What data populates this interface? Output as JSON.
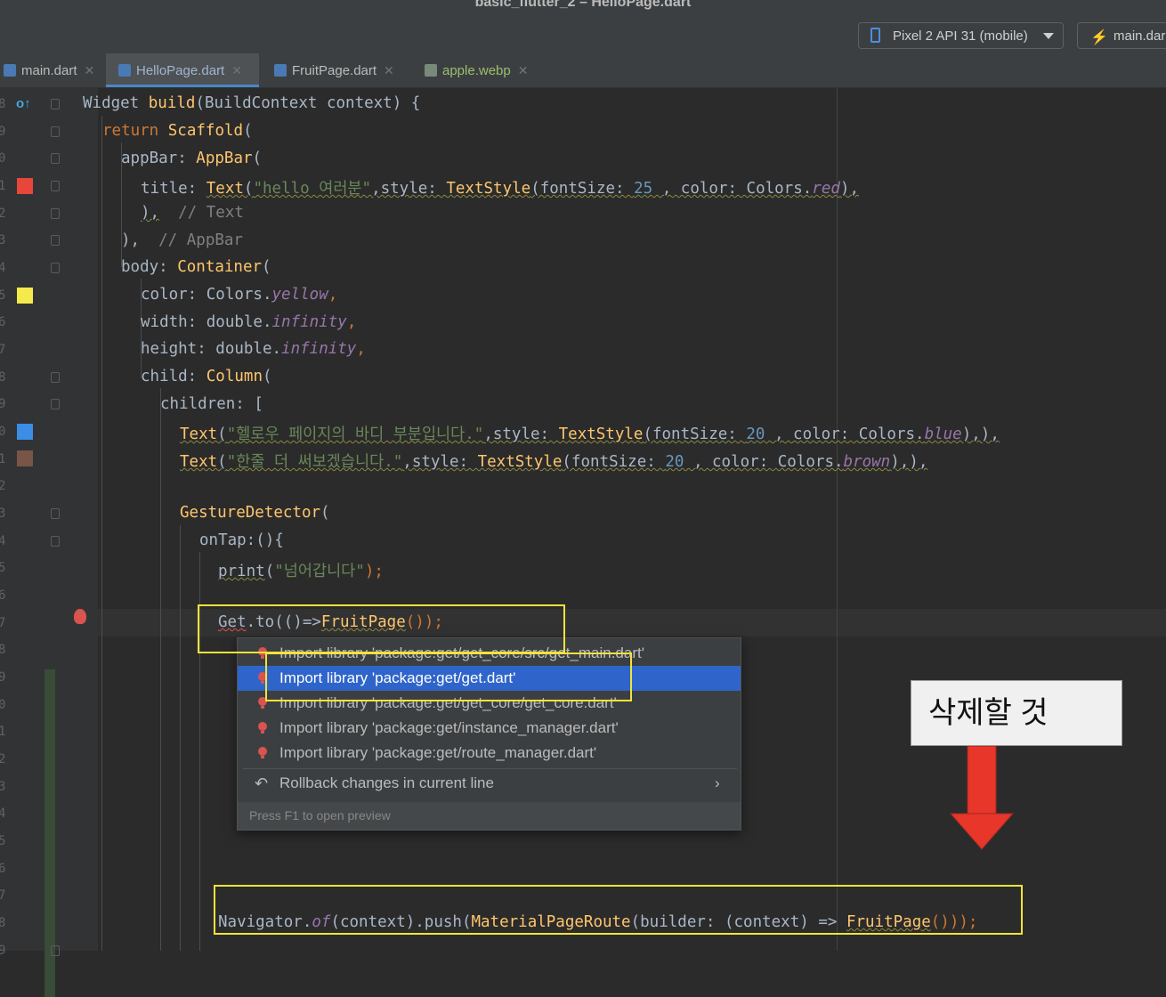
{
  "window": {
    "title": "basic_flutter_2 – HelloPage.dart"
  },
  "toolbar": {
    "device": "Pixel 2 API 31 (mobile)",
    "run_config": "main.dar"
  },
  "tabs": [
    {
      "label": "main.dart",
      "active": false
    },
    {
      "label": "HelloPage.dart",
      "active": true
    },
    {
      "label": "FruitPage.dart",
      "active": false
    },
    {
      "label": "apple.webp",
      "active": false
    }
  ],
  "gutter": {
    "line_numbers": [
      "8",
      "9",
      "0",
      "1",
      "2",
      "3",
      "4",
      "5",
      "6",
      "7",
      "8",
      "9",
      "0",
      "1",
      "2",
      "3",
      "4",
      "5",
      "6",
      "7",
      "8",
      "9",
      "0",
      "1",
      "2",
      "3",
      "4",
      "5",
      "6",
      "7",
      "8",
      "9"
    ],
    "color_swatches": {
      "red": "#e8463a",
      "yellow": "#f6e94c",
      "blue": "#3a8ee6",
      "brown": "#795548"
    }
  },
  "code": {
    "l1": {
      "a": "Widget ",
      "b": "build",
      "c": "(BuildContext context) {"
    },
    "l2": {
      "a": "return ",
      "b": "Scaffold",
      "c": "("
    },
    "l3": {
      "a": "appBar: ",
      "b": "AppBar",
      "c": "("
    },
    "l4": {
      "a": "title: ",
      "b": "Text",
      "c": "(",
      "d": "\"hello 여러분\"",
      "e": ",style: ",
      "f": "TextStyle",
      "g": "(fontSize: ",
      "h": "25",
      "i": " , color: Colors.",
      "j": "red",
      "k": "),",
      "l": ""
    },
    "l5": {
      "a": "),",
      "b": "  // Text"
    },
    "l6": {
      "a": "),",
      "b": "  // AppBar"
    },
    "l7": {
      "a": "body: ",
      "b": "Container",
      "c": "("
    },
    "l8": {
      "a": "color: Colors.",
      "b": "yellow",
      "c": ","
    },
    "l9": {
      "a": "width: double.",
      "b": "infinity",
      "c": ","
    },
    "l10": {
      "a": "height: double.",
      "b": "infinity",
      "c": ","
    },
    "l11": {
      "a": "child: ",
      "b": "Column",
      "c": "("
    },
    "l12": {
      "a": "children: ["
    },
    "l13": {
      "a": "Text",
      "b": "(",
      "c": "\"헬로우 페이지의 바디 부분입니다.\"",
      "d": ",style: ",
      "e": "TextStyle",
      "f": "(fontSize: ",
      "g": "20",
      "h": " , color: Colors.",
      "i": "blue",
      "j": "),),",
      "k": ""
    },
    "l14": {
      "a": "Text",
      "b": "(",
      "c": "\"한줄 더 써보겠습니다.\"",
      "d": ",style: ",
      "e": "TextStyle",
      "f": "(fontSize: ",
      "g": "20",
      "h": " , color: Colors.",
      "i": "brown",
      "j": "),),",
      "k": ""
    },
    "l15": {
      "a": "GestureDetector",
      "b": "("
    },
    "l16": {
      "a": "onTap:(){"
    },
    "l17": {
      "a": "print",
      "b": "(",
      "c": "\"넘어갑니다\"",
      "d": ");"
    },
    "l18": {
      "a": "Get",
      "b": ".to(()=>",
      "c": "FruitPage",
      "d": "());"
    },
    "l19": {
      "a": "Navigator.",
      "b": "of",
      "c": "(context).push(",
      "d": "MaterialPageRoute",
      "e": "(builder: (context) => ",
      "f": "FruitPage",
      "g": "()));"
    }
  },
  "popup": {
    "items": [
      "Import library 'package:get/get_core/src/get_main.dart'",
      "Import library 'package:get/get.dart'",
      "Import library 'package:get/get_core/get_core.dart'",
      "Import library 'package:get/instance_manager.dart'",
      "Import library 'package:get/route_manager.dart'"
    ],
    "selected_index": 1,
    "rollback": "Rollback changes in current line",
    "footer": "Press F1 to open preview"
  },
  "annotation": {
    "text": "삭제할 것",
    "arrow_color": "#e8362a",
    "box_color": "#f2e33a"
  }
}
